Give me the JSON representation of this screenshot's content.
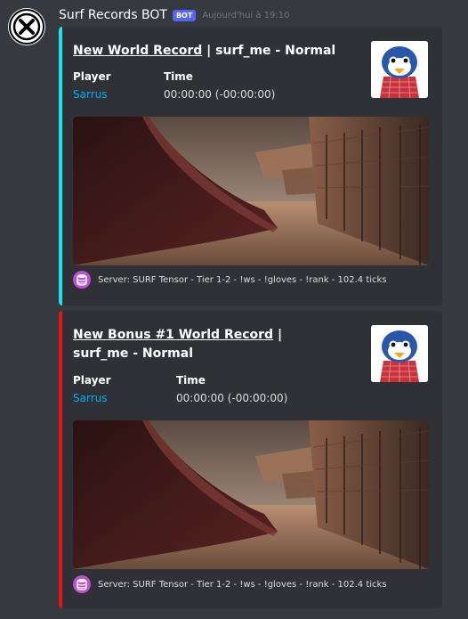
{
  "message": {
    "author": "Surf Records BOT",
    "bot_tag": "BOT",
    "timestamp": "Aujourd'hui à 19:10",
    "avatar_icon": "close-circle-icon"
  },
  "embeds": [
    {
      "color": "#1ee1ee",
      "title_link": "New World Record",
      "title_rest": " | surf_me - Normal",
      "thumbnail_icon": "penguin-avatar",
      "fields": [
        {
          "name": "Player",
          "value": "Sarrus"
        },
        {
          "name": "Time",
          "value": "00:00:00 (-00:00:00)"
        }
      ],
      "image": "surf map screenshot",
      "footer_icon": "database-icon",
      "footer": "Server: SURF Tensor - Tier 1-2 - !ws - !gloves - !rank - 102.4 ticks"
    },
    {
      "color": "#e91318",
      "title_link": "New Bonus #1 World Record",
      "title_rest": " | surf_me - Normal",
      "thumbnail_icon": "penguin-avatar",
      "fields": [
        {
          "name": "Player",
          "value": "Sarrus"
        },
        {
          "name": "Time",
          "value": "00:00:00 (-00:00:00)"
        }
      ],
      "image": "surf map screenshot",
      "footer_icon": "database-icon",
      "footer": "Server: SURF Tensor - Tier 1-2 - !ws - !gloves - !rank - 102.4 ticks"
    }
  ]
}
